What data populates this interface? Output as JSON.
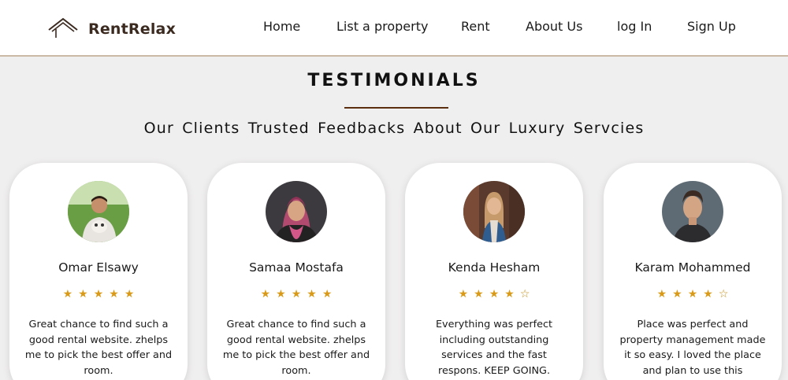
{
  "nav": {
    "brand": "RentRelax",
    "links": [
      "Home",
      "List a property",
      "Rent",
      "About Us",
      "log In",
      "Sign Up"
    ]
  },
  "section": {
    "title": "TESTIMONIALS",
    "subtitle": "Our Clients Trusted Feedbacks About Our Luxury Servcies"
  },
  "testimonials": [
    {
      "name": "Omar Elsawy",
      "rating": 5,
      "text": "Great chance to find such a good rental website. zhelps me to pick the best offer and room."
    },
    {
      "name": "Samaa Mostafa",
      "rating": 5,
      "text": "Great chance to find such a good rental website. zhelps me to pick the best offer and room."
    },
    {
      "name": "Kenda Hesham",
      "rating": 4,
      "text": "Everything was perfect including outstanding services and the fast respons. KEEP GOING."
    },
    {
      "name": "Karam Mohammed",
      "rating": 4,
      "text": "Place was perfect and property management made it so easy. I loved the place and plan to use this"
    }
  ],
  "stars_max": 5,
  "icons": {
    "logo": "house-roof-icon",
    "star_filled": "star-icon",
    "star_empty": "star-outline-icon"
  },
  "colors": {
    "accent": "#d89a18",
    "brand": "#3b2a20",
    "rule": "#5a2e0e",
    "background": "#f0efef"
  }
}
